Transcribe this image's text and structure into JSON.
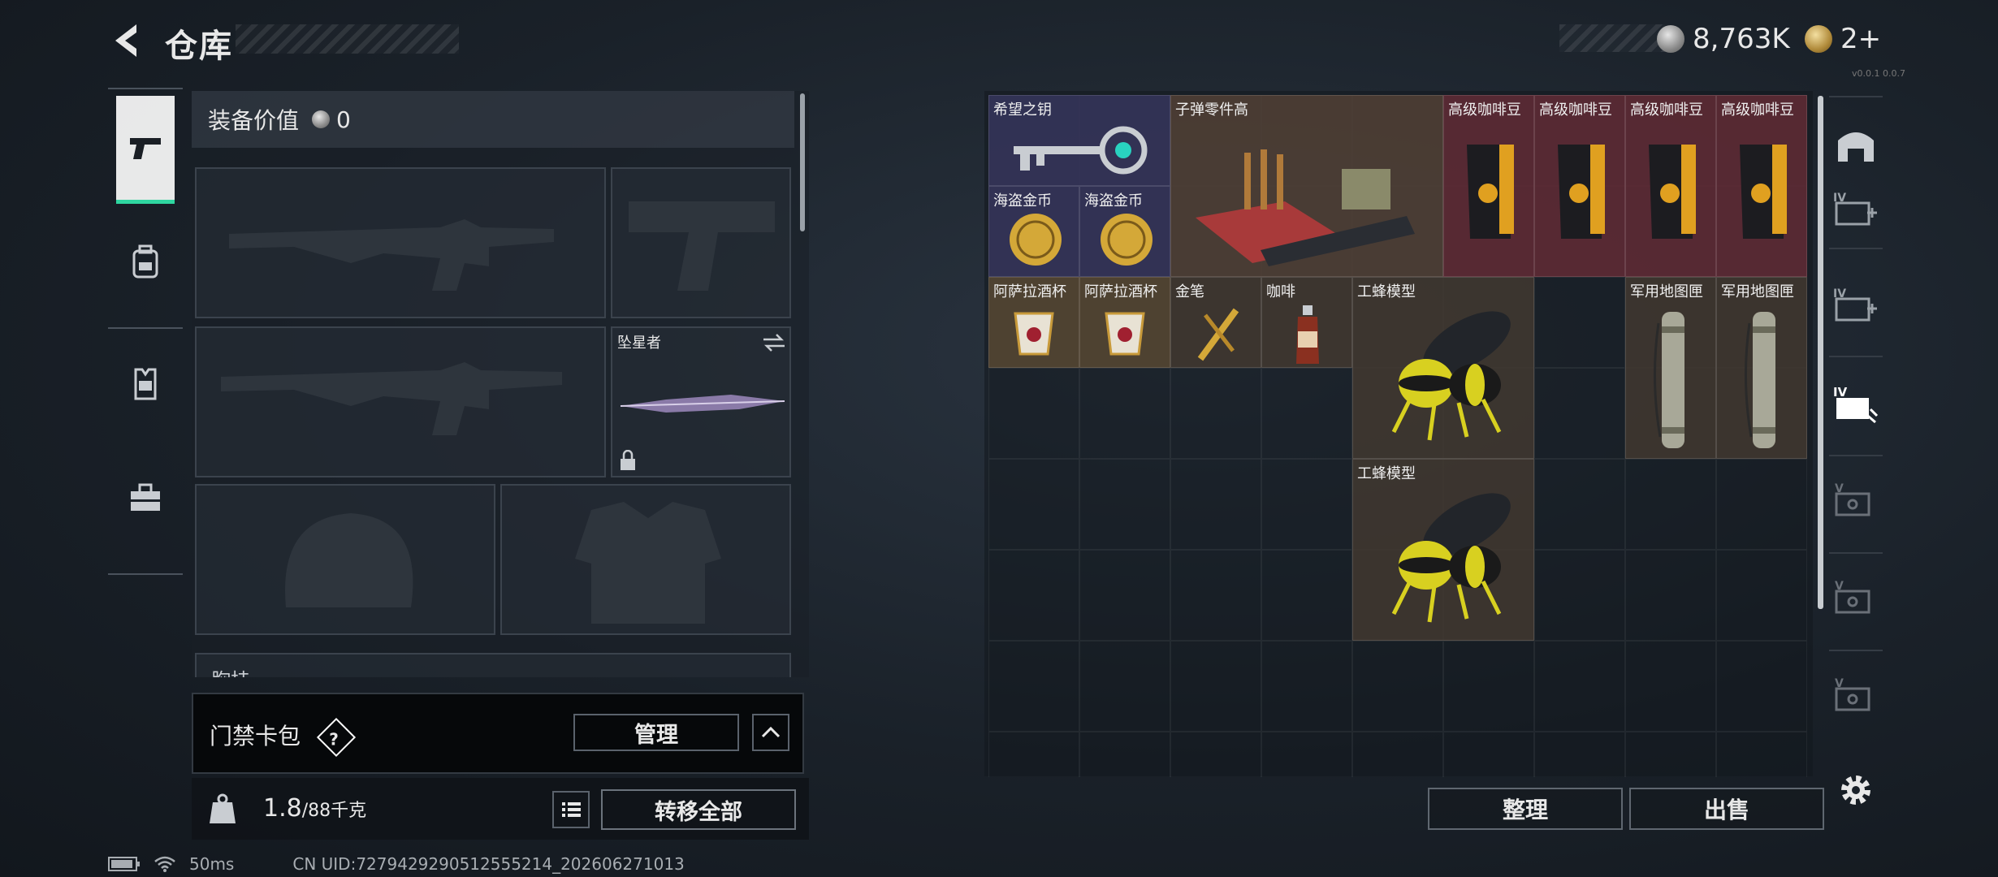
{
  "header": {
    "title": "仓库",
    "back_icon": "back-arrow-icon"
  },
  "currency": {
    "silver": "8,763K",
    "gold": "2+",
    "version": "v0.0.1 0.0.7"
  },
  "equipment": {
    "value_label": "装备价值",
    "value": "0",
    "slots": [
      {
        "name": "primary-weapon-slot",
        "label": ""
      },
      {
        "name": "pistol-slot",
        "label": ""
      },
      {
        "name": "secondary-weapon-slot",
        "label": ""
      },
      {
        "name": "melee-slot",
        "label": "坠星者"
      },
      {
        "name": "helmet-slot",
        "label": ""
      },
      {
        "name": "armor-slot",
        "label": ""
      }
    ],
    "next_section": "胸挂"
  },
  "card_bag": {
    "label": "门禁卡包",
    "help": "?",
    "manage_label": "管理"
  },
  "bottom_bar": {
    "weight": "1.8",
    "weight_max": "/88千克",
    "transfer_label": "转移全部"
  },
  "storage": {
    "items": [
      {
        "name": "希望之钥",
        "color": "purple"
      },
      {
        "name": "子弹零件高",
        "color": "brown"
      },
      {
        "name": "高级咖啡豆",
        "color": "red"
      },
      {
        "name": "高级咖啡豆",
        "color": "red"
      },
      {
        "name": "高级咖啡豆",
        "color": "red"
      },
      {
        "name": "高级咖啡豆",
        "color": "red"
      },
      {
        "name": "海盗金币",
        "color": "purple"
      },
      {
        "name": "海盗金币",
        "color": "purple"
      },
      {
        "name": "阿萨拉酒杯",
        "color": "brown"
      },
      {
        "name": "阿萨拉酒杯",
        "color": "brown"
      },
      {
        "name": "金笔",
        "color": "brown"
      },
      {
        "name": "咖啡",
        "color": "brown"
      },
      {
        "name": "工蜂模型",
        "color": "brown"
      },
      {
        "name": "军用地图匣",
        "color": "brown"
      },
      {
        "name": "军用地图匣",
        "color": "brown"
      },
      {
        "name": "工蜂模型",
        "color": "brown"
      }
    ],
    "sort_label": "整理",
    "sell_label": "出售"
  },
  "status_bar": {
    "ping": "50ms",
    "uid": "CN UID:7279429290512555214_202606271013"
  },
  "colors": {
    "accent": "#2fd6a0",
    "purple_item": "#343458",
    "brown_item": "#504036",
    "red_item": "#5c2a34"
  }
}
